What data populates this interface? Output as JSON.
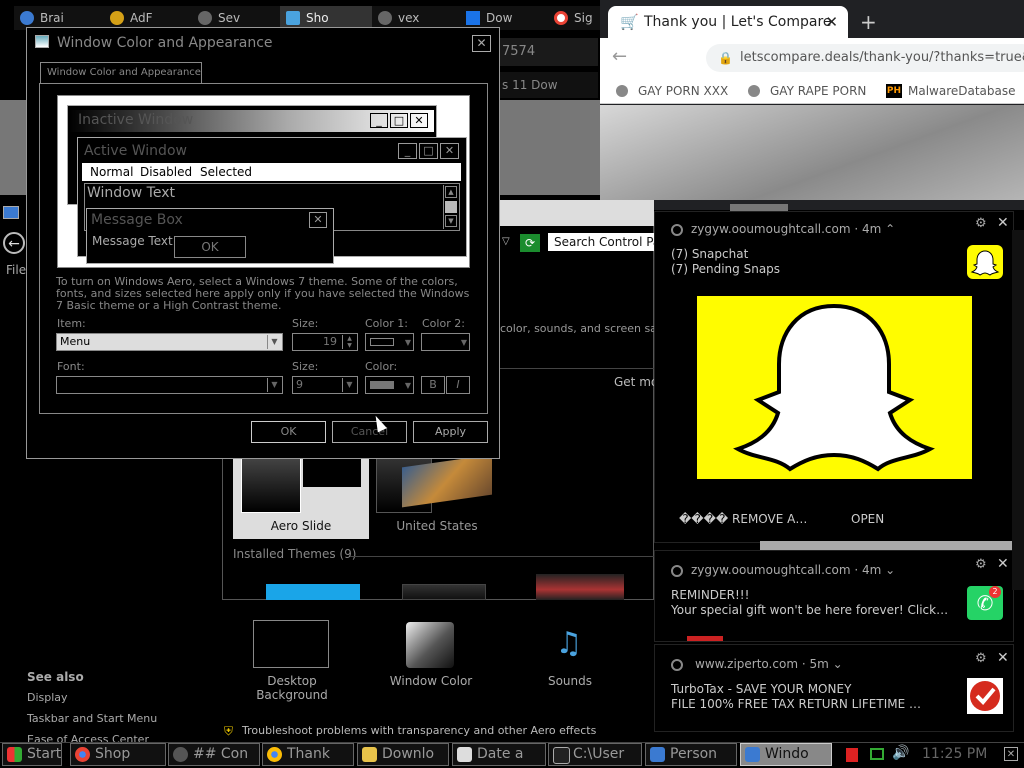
{
  "browser_left": {
    "tabs": [
      "Brai",
      "AdF",
      "Sev",
      "Sho",
      "vex",
      "Dow",
      "Sig"
    ],
    "address_fragment": "7574",
    "bookmark_fragment": "s 11 Dow"
  },
  "browser_right": {
    "tab_title": "Thank you | Let's Compare",
    "new_tab": "+",
    "url": "letscompare.deals/thank-you/?thanks=true&",
    "bookmarks": [
      "GAY PORN XXX",
      "GAY RAPE PORN",
      "MalwareDatabase"
    ],
    "ph_badge": "PH"
  },
  "dialog": {
    "title": "Window Color and Appearance",
    "tab": "Window Color and Appearance",
    "preview": {
      "inactive_window": "Inactive Window",
      "active_window": "Active Window",
      "menu_normal": "Normal",
      "menu_disabled": "Disabled",
      "menu_selected": "Selected",
      "window_text": "Window Text",
      "message_box": "Message Box",
      "message_text": "Message Text",
      "ok": "OK"
    },
    "info": "To turn on Windows Aero, select a Windows 7 theme.  Some of the colors, fonts, and sizes selected here apply only if you have selected the Windows 7 Basic theme or a High Contrast theme.",
    "item_label": "Item:",
    "item_value": "Menu",
    "size_label": "Size:",
    "size_value": "19",
    "color1_label": "Color 1:",
    "color2_label": "Color 2:",
    "font_label": "Font:",
    "font_size_label": "Size:",
    "font_size_value": "9",
    "font_color_label": "Color:",
    "bold": "B",
    "italic": "I",
    "ok_button": "OK",
    "cancel_button": "Cancel",
    "apply_button": "Apply"
  },
  "control_panel": {
    "search_placeholder": "Search Control Panel",
    "desc_fragment": "color, sounds, and screen saver",
    "get_more": "Get mo",
    "themes": [
      "Aero Slide",
      "United States"
    ],
    "installed_themes": "Installed Themes (9)",
    "bottom_items": [
      "Desktop Background",
      "Window Color",
      "Sounds"
    ],
    "see_also_title": "See also",
    "see_also": [
      "Display",
      "Taskbar and Start Menu",
      "Ease of Access Center"
    ],
    "troubleshoot": "Troubleshoot problems with transparency and other Aero effects",
    "file_label": "File"
  },
  "notifications": [
    {
      "source": "zygyw.ooumoughtcall.com",
      "time": "4m",
      "line1": "(7) Snapchat",
      "line2": "(7) Pending Snaps",
      "action1": "���� REMOVE A…",
      "action2": "OPEN"
    },
    {
      "source": "zygyw.ooumoughtcall.com",
      "time": "4m",
      "line1": "REMINDER!!!",
      "line2": "Your special gift won't be here forever! Click…",
      "badge": "2"
    },
    {
      "source": "www.ziperto.com",
      "time": "5m",
      "line1": "TurboTax - SAVE YOUR MONEY",
      "line2": "FILE 100% FREE TAX RETURN LIFETIME …"
    }
  ],
  "taskbar": {
    "start": "Start",
    "items": [
      "Shop",
      "## Con",
      "Thank",
      "Downlo",
      "Date a",
      "C:\\User",
      "Person",
      "Windo"
    ],
    "clock": "11:25 PM"
  },
  "colors": {
    "snapchat_yellow": "#FFFC00",
    "whatsapp_green": "#25D366",
    "turbotax_red": "#D52B1E"
  }
}
